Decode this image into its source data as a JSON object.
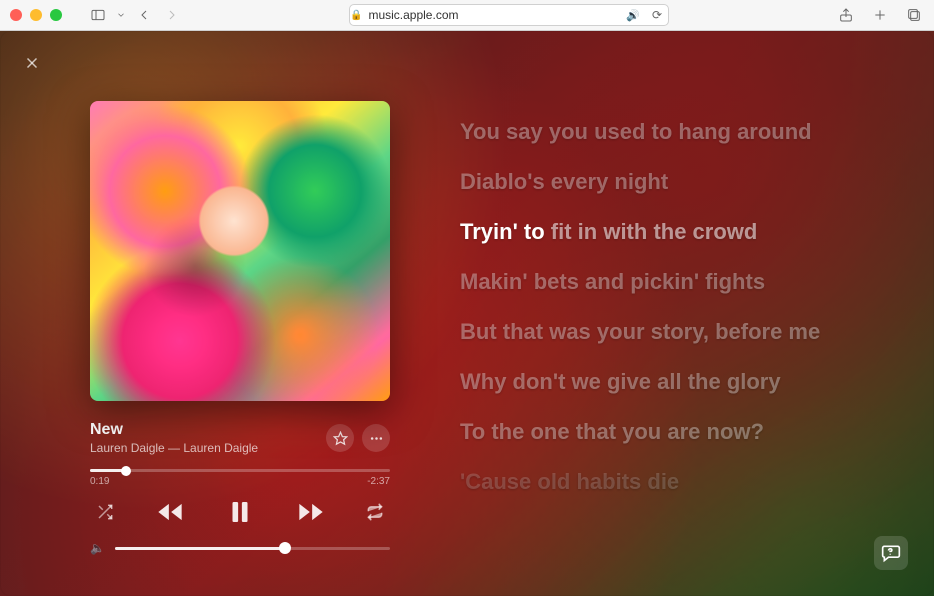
{
  "browser": {
    "url": "music.apple.com"
  },
  "player": {
    "track_title": "New",
    "track_subtitle": "Lauren Daigle — Lauren Daigle",
    "elapsed": "0:19",
    "remaining": "-2:37"
  },
  "lyrics": {
    "lines": [
      "You say you used to hang around",
      "Diablo's every night",
      "Tryin' to ",
      "Makin' bets and pickin' fights",
      "But that was your story, before me",
      "Why don't we give all the glory",
      "To the one that you are now?",
      "'Cause old habits die"
    ],
    "current_trail": "fit in with the crowd"
  }
}
